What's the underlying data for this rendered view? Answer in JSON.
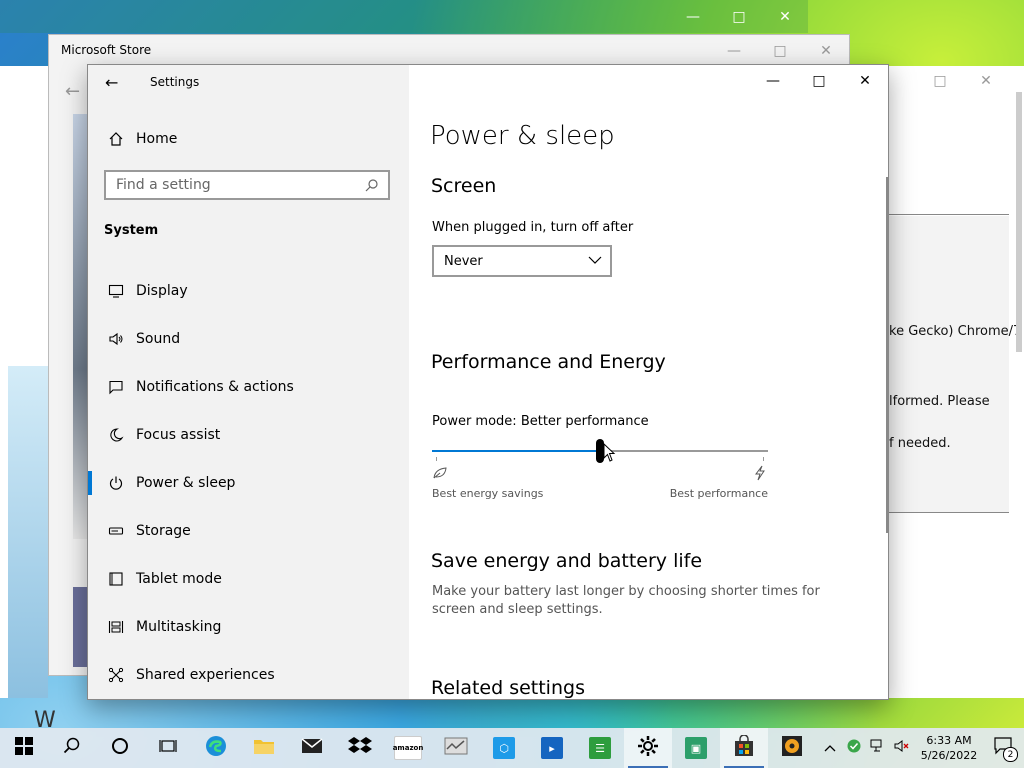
{
  "background": {
    "store_title": "Microsoft Store",
    "left_letter": "W",
    "chrome_lines": [
      "ke Gecko) Chrome/7",
      "lformed. Please",
      "f needed."
    ]
  },
  "settings": {
    "app_title": "Settings",
    "home_label": "Home",
    "search_placeholder": "Find a setting",
    "group_label": "System",
    "nav": [
      {
        "label": "Display",
        "icon": "monitor-icon"
      },
      {
        "label": "Sound",
        "icon": "speaker-icon"
      },
      {
        "label": "Notifications & actions",
        "icon": "notification-icon"
      },
      {
        "label": "Focus assist",
        "icon": "moon-icon"
      },
      {
        "label": "Power & sleep",
        "icon": "power-icon",
        "active": true
      },
      {
        "label": "Storage",
        "icon": "storage-icon"
      },
      {
        "label": "Tablet mode",
        "icon": "tablet-icon"
      },
      {
        "label": "Multitasking",
        "icon": "multitasking-icon"
      },
      {
        "label": "Shared experiences",
        "icon": "shared-icon"
      }
    ],
    "page_title": "Power & sleep",
    "screen_heading": "Screen",
    "plugged_label": "When plugged in, turn off after",
    "plugged_value": "Never",
    "perf_heading": "Performance and Energy",
    "power_mode_label": "Power mode: Better performance",
    "power_mode_level": 0.5,
    "slider_left_caption": "Best energy savings",
    "slider_right_caption": "Best performance",
    "save_heading": "Save energy and battery life",
    "save_text": "Make your battery last longer by choosing shorter times for screen and sleep settings.",
    "related_heading": "Related settings"
  },
  "taskbar": {
    "time": "6:33 AM",
    "date": "5/26/2022",
    "notification_count": "2",
    "amazon_label": "amazon"
  },
  "colors": {
    "accent": "#0078d4"
  }
}
